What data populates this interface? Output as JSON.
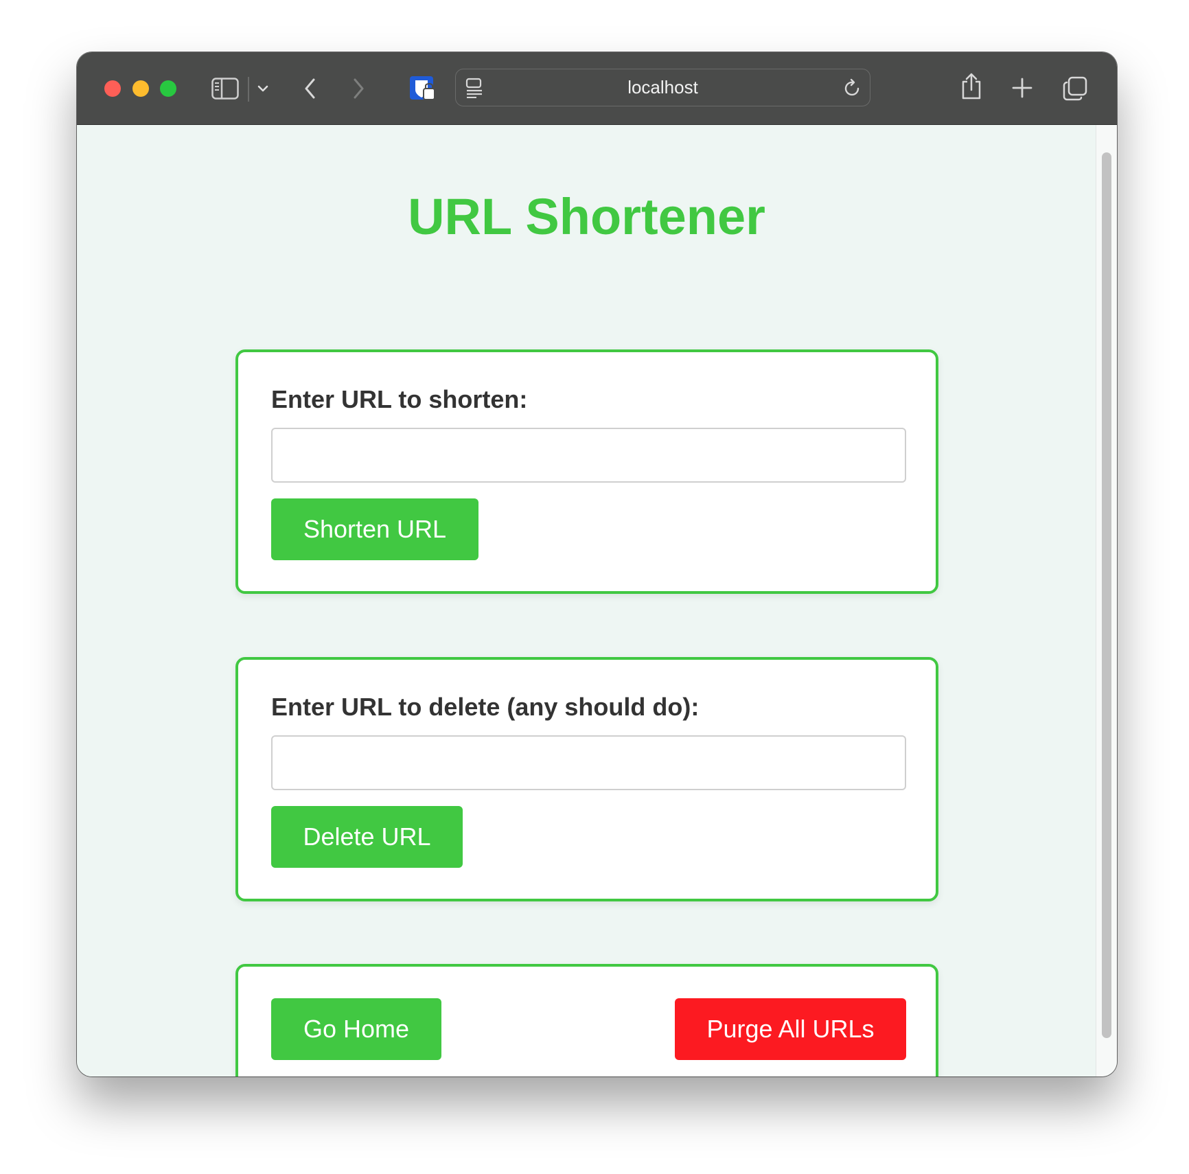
{
  "browser": {
    "address": "localhost"
  },
  "page": {
    "title": "URL Shortener"
  },
  "shorten_card": {
    "label": "Enter URL to shorten:",
    "input_value": "",
    "input_placeholder": "",
    "button_label": "Shorten URL"
  },
  "delete_card": {
    "label": "Enter URL to delete (any should do):",
    "input_value": "",
    "input_placeholder": "",
    "button_label": "Delete URL"
  },
  "actions_card": {
    "home_button_label": "Go Home",
    "purge_button_label": "Purge All URLs"
  },
  "colors": {
    "accent_green": "#41c842",
    "danger_red": "#fc1a21",
    "page_background": "#eef6f3",
    "titlebar": "#4a4b4a"
  }
}
